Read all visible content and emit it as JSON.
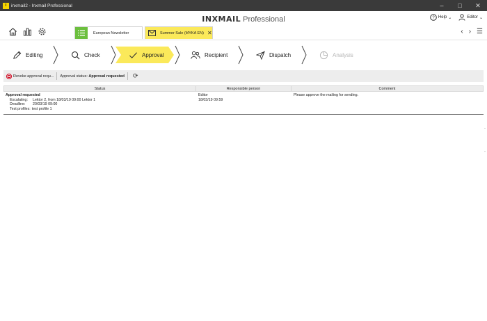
{
  "window": {
    "title": "inxmail2 - Inxmail Professional",
    "controls": [
      "minimize",
      "maximize",
      "close"
    ]
  },
  "header": {
    "brand_bold": "INXMAIL",
    "brand_light": "Professional",
    "help_label": "Help",
    "user_label": "Editor",
    "tabs": [
      {
        "label": "European Newsletter",
        "active": false
      },
      {
        "label": "Summer Sale (MYKA EN)",
        "active": true
      }
    ]
  },
  "steps": [
    {
      "label": "Editing",
      "icon": "pencil-icon",
      "state": "normal"
    },
    {
      "label": "Check",
      "icon": "magnifier-icon",
      "state": "normal"
    },
    {
      "label": "Approval",
      "icon": "checkmark-icon",
      "state": "active"
    },
    {
      "label": "Recipient",
      "icon": "people-icon",
      "state": "normal"
    },
    {
      "label": "Dispatch",
      "icon": "paper-plane-icon",
      "state": "normal"
    },
    {
      "label": "Analysis",
      "icon": "pie-chart-icon",
      "state": "disabled"
    }
  ],
  "toolbar": {
    "revoke_label": "Revoke approval requ...",
    "status_prefix": "Approval status:",
    "status_value": "Approval requested"
  },
  "table": {
    "columns": [
      "Status",
      "Responsible person",
      "Comment"
    ],
    "rows": [
      {
        "status_title": "Approval requested",
        "escalating_key": "Escalating:",
        "escalating_value": "Lektor 2, from 18/03/19 09:00 Lektor 1",
        "deadline_key": "Deadline:",
        "deadline_value": "20/03/19 09:00",
        "test_profiles_key": "Test profiles:",
        "test_profiles_value": "test profile 1",
        "person": "Editor",
        "person_date": "18/03/19 09:59",
        "comment": "Please approve the mailing for sending."
      }
    ]
  },
  "colors": {
    "accent_yellow": "#fbe95a",
    "tab_green": "#6cbf3e",
    "titlebar": "#3a3a3a",
    "revoke_red": "#d0021b"
  }
}
